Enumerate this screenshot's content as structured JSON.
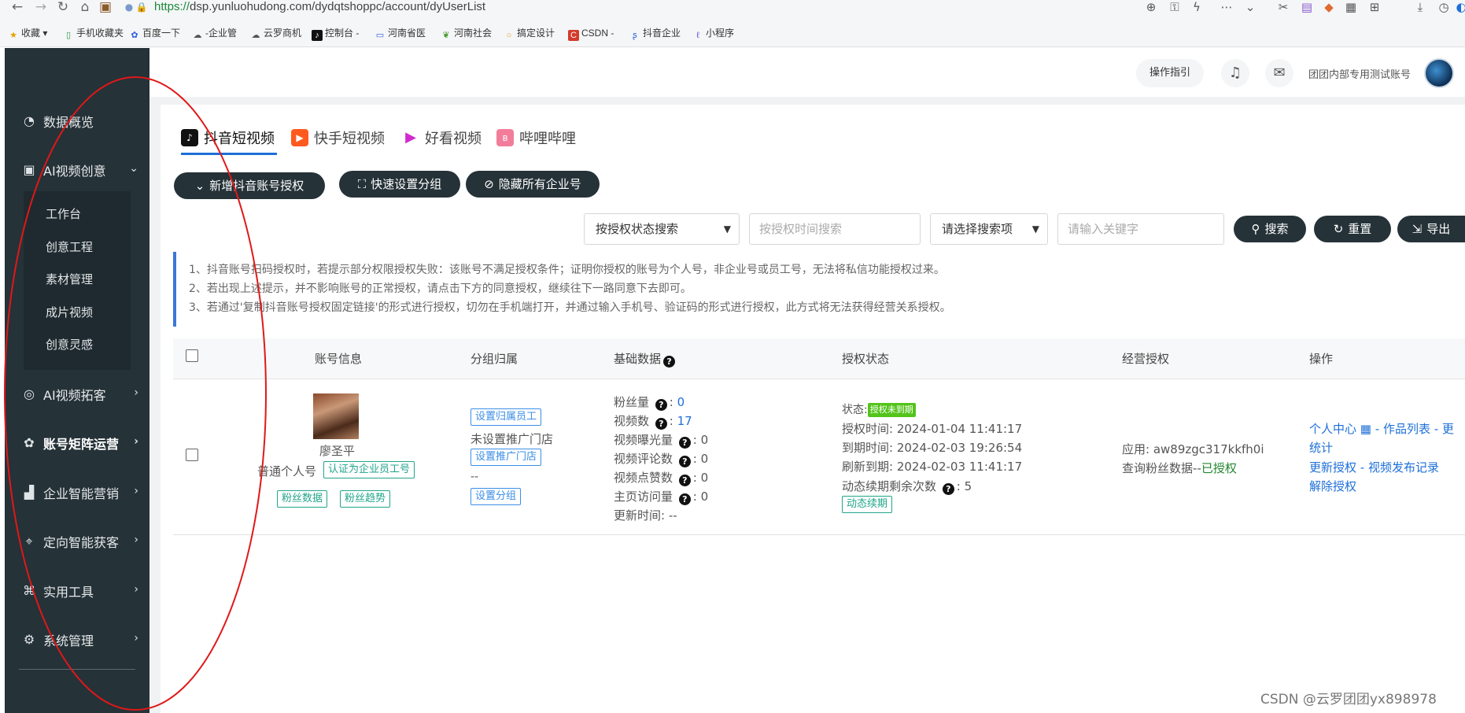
{
  "browser": {
    "url_scheme": "https://",
    "url_rest": "dsp.yunluohudong.com/dydqtshoppc/account/dyUserList",
    "bookmarks": [
      "收藏",
      "手机收藏夹",
      "百度一下",
      "-企业管",
      "云罗商机",
      "控制台 -",
      "河南省医",
      "河南社会",
      "搞定设计",
      "CSDN -",
      "抖音企业",
      "小程序"
    ]
  },
  "sidebar": {
    "items": [
      {
        "label": "数据概览",
        "icon": "dashboard-icon"
      },
      {
        "label": "AI视频创意",
        "icon": "video-icon"
      },
      {
        "label": "AI视频拓客",
        "icon": "target-icon"
      },
      {
        "label": "账号矩阵运营",
        "icon": "matrix-icon"
      },
      {
        "label": "企业智能营销",
        "icon": "chart-icon"
      },
      {
        "label": "定向智能获客",
        "icon": "location-icon"
      },
      {
        "label": "实用工具",
        "icon": "tools-icon"
      },
      {
        "label": "系统管理",
        "icon": "gear-icon"
      }
    ],
    "submenu": [
      "工作台",
      "创意工程",
      "素材管理",
      "成片视频",
      "创意灵感"
    ]
  },
  "header": {
    "guide": "操作指引",
    "account_name": "团团内部专用测试账号"
  },
  "platform_tabs": [
    "抖音短视频",
    "快手短视频",
    "好看视频",
    "哔哩哔哩"
  ],
  "actions": {
    "add": "新增抖音账号授权",
    "group": "快速设置分组",
    "hide": "隐藏所有企业号"
  },
  "search": {
    "status_select": "按授权状态搜索",
    "time_placeholder": "按授权时间搜索",
    "field_select": "请选择搜索项",
    "keyword_placeholder": "请输入关键字",
    "search_btn": "搜索",
    "reset_btn": "重置",
    "export_btn": "导出"
  },
  "notice": [
    "1、抖音账号扫码授权时，若提示部分权限授权失败：该账号不满足授权条件；证明你授权的账号为个人号，非企业号或员工号，无法将私信功能授权过来。",
    "2、若出现上述提示，并不影响账号的正常授权，请点击下方的同意授权，继续往下一路同意下去即可。",
    "3、若通过'复制抖音账号授权固定链接'的形式进行授权，切勿在手机端打开，并通过输入手机号、验证码的形式进行授权，此方式将无法获得经营关系授权。"
  ],
  "table": {
    "headers": [
      "账号信息",
      "分组归属",
      "基础数据",
      "授权状态",
      "经营授权",
      "操作"
    ],
    "row": {
      "name": "廖圣平",
      "type": "普通个人号",
      "verify_tag": "认证为企业员工号",
      "fans_data_tag": "粉丝数据",
      "fans_trend_tag": "粉丝趋势",
      "group": {
        "set_staff": "设置归属员工",
        "store_status": "未设置推广门店",
        "set_store": "设置推广门店",
        "dash": "--",
        "set_group": "设置分组"
      },
      "basic": {
        "fans_label": "粉丝量",
        "fans": "0",
        "videos_label": "视频数",
        "videos": "17",
        "exposure_label": "视频曝光量",
        "exposure": "0",
        "comments_label": "视频评论数",
        "comments": "0",
        "likes_label": "视频点赞数",
        "likes": "0",
        "visits_label": "主页访问量",
        "visits": "0",
        "updated_label": "更新时间:",
        "updated": "--"
      },
      "auth": {
        "status_label": "状态:",
        "status": "授权未到期",
        "auth_time": "授权时间:  2024-01-04 11:41:17",
        "expire_time": "到期时间:  2024-02-03 19:26:54",
        "refresh_time": "刷新到期:  2024-02-03 11:41:17",
        "remaining_label": "动态续期剩余次数",
        "remaining": "5",
        "renew_tag": "动态续期"
      },
      "business": {
        "app": "应用:  aw89zgc317kkfh0i",
        "fans_query": "查询粉丝数据--",
        "fans_query_status": "已授权"
      },
      "ops": {
        "personal_center": "个人中心",
        "works_list": "作品列表",
        "more": "更",
        "stats": "统计",
        "reauth": "更新授权",
        "publish_log": "视频发布记录",
        "revoke": "解除授权"
      }
    }
  },
  "watermark": "CSDN @云罗团团yx898978"
}
